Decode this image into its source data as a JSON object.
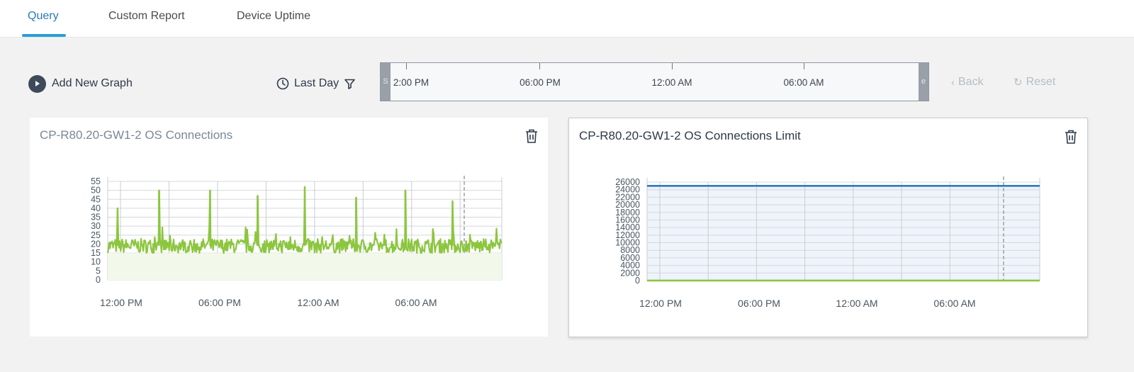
{
  "tabs": [
    {
      "label": "Query",
      "active": true
    },
    {
      "label": "Custom Report",
      "active": false
    },
    {
      "label": "Device Uptime",
      "active": false
    }
  ],
  "toolbar": {
    "add_graph_label": "Add New Graph",
    "time_range_label": "Last Day",
    "back_label": "Back",
    "reset_label": "Reset"
  },
  "slider": {
    "start_handle": "S",
    "end_handle": "e",
    "ticks": [
      "2:00 PM",
      "06:00 PM",
      "12:00 AM",
      "06:00 AM"
    ]
  },
  "colors": {
    "accent": "#2a9fd6",
    "series_green": "#8cc63f",
    "series_blue": "#2c7bc2"
  },
  "panels": [
    {
      "title": "CP-R80.20-GW1-2 OS Connections",
      "chart_data": {
        "type": "line",
        "x_ticks": [
          "12:00 PM",
          "06:00 PM",
          "12:00 AM",
          "06:00 AM"
        ],
        "yticks": [
          0,
          5,
          10,
          15,
          20,
          25,
          30,
          35,
          40,
          45,
          50,
          55
        ],
        "ylim": [
          0,
          55
        ],
        "grid": true,
        "marker_line": "dashed vertical near 08:30 AM",
        "series": [
          {
            "color": "#8cc63f",
            "fill": "#f2f8ea",
            "baseline": 19,
            "noise_range": [
              13,
              27
            ],
            "spikes": [
              {
                "t": 0.025,
                "v": 40
              },
              {
                "t": 0.13,
                "v": 50
              },
              {
                "t": 0.26,
                "v": 50
              },
              {
                "t": 0.38,
                "v": 47
              },
              {
                "t": 0.5,
                "v": 52
              },
              {
                "t": 0.63,
                "v": 46
              },
              {
                "t": 0.755,
                "v": 50
              },
              {
                "t": 0.875,
                "v": 44
              }
            ]
          }
        ]
      }
    },
    {
      "title": "CP-R80.20-GW1-2 OS Connections Limit",
      "chart_data": {
        "type": "area",
        "x_ticks": [
          "12:00 PM",
          "06:00 PM",
          "12:00 AM",
          "06:00 AM"
        ],
        "yticks": [
          0,
          2000,
          4000,
          6000,
          8000,
          10000,
          12000,
          14000,
          16000,
          18000,
          20000,
          22000,
          24000,
          26000
        ],
        "ylim": [
          0,
          26000
        ],
        "grid": true,
        "marker_line": "dashed vertical near 08:30 AM",
        "series": [
          {
            "color": "#2c7bc2",
            "fill": "#eef4fb",
            "value": 25000
          },
          {
            "color": "#8cc63f",
            "value": 20
          }
        ]
      }
    }
  ]
}
